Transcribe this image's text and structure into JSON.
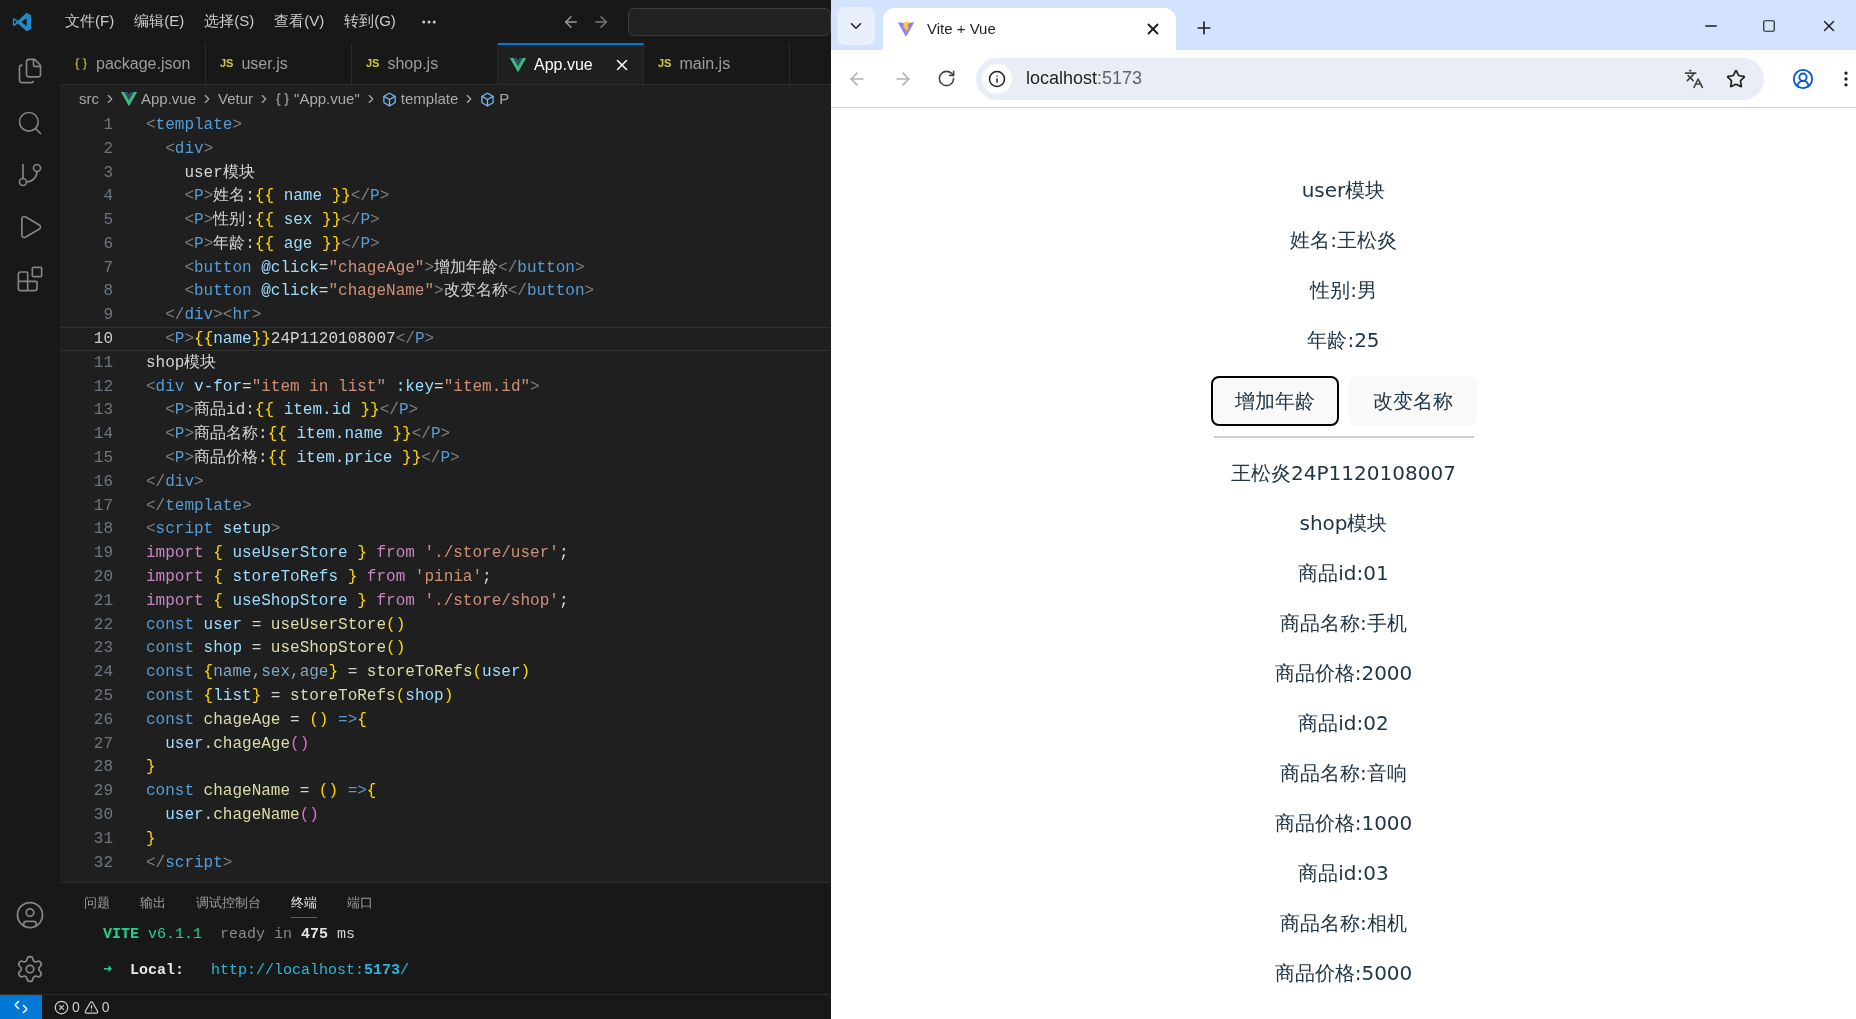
{
  "editor": {
    "menu": [
      "文件(F)",
      "编辑(E)",
      "选择(S)",
      "查看(V)",
      "转到(G)"
    ],
    "tabs": [
      {
        "label": "package.json",
        "kind": "json",
        "selected": false
      },
      {
        "label": "user.js",
        "kind": "js",
        "badge": "JS",
        "selected": false
      },
      {
        "label": "shop.js",
        "kind": "js",
        "badge": "JS",
        "selected": false
      },
      {
        "label": "App.vue",
        "kind": "vue",
        "selected": true
      },
      {
        "label": "main.js",
        "kind": "js",
        "badge": "JS",
        "selected": false
      }
    ],
    "breadcrumb": [
      {
        "label": "src",
        "kind": "folder"
      },
      {
        "label": "App.vue",
        "kind": "vue"
      },
      {
        "label": "Vetur",
        "kind": "plain"
      },
      {
        "label": "\"App.vue\"",
        "kind": "braces"
      },
      {
        "label": "template",
        "kind": "element"
      },
      {
        "label": "P",
        "kind": "element"
      }
    ],
    "lines": [
      {
        "number": "1",
        "active": false,
        "tokens": [
          {
            "text": "<",
            "kind": "punct"
          },
          {
            "text": "template",
            "kind": "tag"
          },
          {
            "text": ">",
            "kind": "punct"
          }
        ]
      },
      {
        "number": "2",
        "active": false,
        "tokens": [
          {
            "text": "  <",
            "kind": "punct"
          },
          {
            "text": "div",
            "kind": "tag"
          },
          {
            "text": ">",
            "kind": "punct"
          }
        ]
      },
      {
        "number": "3",
        "active": false,
        "tokens": [
          {
            "text": "    user模块",
            "kind": "text"
          }
        ]
      },
      {
        "number": "4",
        "active": false,
        "tokens": [
          {
            "text": "    <",
            "kind": "punct"
          },
          {
            "text": "P",
            "kind": "tag"
          },
          {
            "text": ">",
            "kind": "punct"
          },
          {
            "text": "姓名:",
            "kind": "text"
          },
          {
            "text": "{{",
            "kind": "bracket"
          },
          {
            "text": " name ",
            "kind": "var"
          },
          {
            "text": "}}",
            "kind": "bracket"
          },
          {
            "text": "</",
            "kind": "punct"
          },
          {
            "text": "P",
            "kind": "tag"
          },
          {
            "text": ">",
            "kind": "punct"
          }
        ]
      },
      {
        "number": "5",
        "active": false,
        "tokens": [
          {
            "text": "    <",
            "kind": "punct"
          },
          {
            "text": "P",
            "kind": "tag"
          },
          {
            "text": ">",
            "kind": "punct"
          },
          {
            "text": "性别:",
            "kind": "text"
          },
          {
            "text": "{{",
            "kind": "bracket"
          },
          {
            "text": " sex ",
            "kind": "var"
          },
          {
            "text": "}}",
            "kind": "bracket"
          },
          {
            "text": "</",
            "kind": "punct"
          },
          {
            "text": "P",
            "kind": "tag"
          },
          {
            "text": ">",
            "kind": "punct"
          }
        ]
      },
      {
        "number": "6",
        "active": false,
        "tokens": [
          {
            "text": "    <",
            "kind": "punct"
          },
          {
            "text": "P",
            "kind": "tag"
          },
          {
            "text": ">",
            "kind": "punct"
          },
          {
            "text": "年龄:",
            "kind": "text"
          },
          {
            "text": "{{",
            "kind": "bracket"
          },
          {
            "text": " age ",
            "kind": "var"
          },
          {
            "text": "}}",
            "kind": "bracket"
          },
          {
            "text": "</",
            "kind": "punct"
          },
          {
            "text": "P",
            "kind": "tag"
          },
          {
            "text": ">",
            "kind": "punct"
          }
        ]
      },
      {
        "number": "7",
        "active": false,
        "tokens": [
          {
            "text": "    <",
            "kind": "punct"
          },
          {
            "text": "button",
            "kind": "tag"
          },
          {
            "text": " @click",
            "kind": "var"
          },
          {
            "text": "=",
            "kind": "text"
          },
          {
            "text": "\"chageAge\"",
            "kind": "string"
          },
          {
            "text": ">",
            "kind": "punct"
          },
          {
            "text": "增加年龄",
            "kind": "text"
          },
          {
            "text": "</",
            "kind": "punct"
          },
          {
            "text": "button",
            "kind": "tag"
          },
          {
            "text": ">",
            "kind": "punct"
          }
        ]
      },
      {
        "number": "8",
        "active": false,
        "tokens": [
          {
            "text": "    <",
            "kind": "punct"
          },
          {
            "text": "button",
            "kind": "tag"
          },
          {
            "text": " @click",
            "kind": "var"
          },
          {
            "text": "=",
            "kind": "text"
          },
          {
            "text": "\"chageName\"",
            "kind": "string"
          },
          {
            "text": ">",
            "kind": "punct"
          },
          {
            "text": "改变名称",
            "kind": "text"
          },
          {
            "text": "</",
            "kind": "punct"
          },
          {
            "text": "button",
            "kind": "tag"
          },
          {
            "text": ">",
            "kind": "punct"
          }
        ]
      },
      {
        "number": "9",
        "active": false,
        "tokens": [
          {
            "text": "  </",
            "kind": "punct"
          },
          {
            "text": "div",
            "kind": "tag"
          },
          {
            "text": "><",
            "kind": "punct"
          },
          {
            "text": "hr",
            "kind": "tag"
          },
          {
            "text": ">",
            "kind": "punct"
          }
        ]
      },
      {
        "number": "10",
        "active": true,
        "tokens": [
          {
            "text": "  <",
            "kind": "punct"
          },
          {
            "text": "P",
            "kind": "tag"
          },
          {
            "text": ">",
            "kind": "punct"
          },
          {
            "text": "{{",
            "kind": "bracket"
          },
          {
            "text": "name",
            "kind": "var"
          },
          {
            "text": "}}",
            "kind": "bracket"
          },
          {
            "text": "24P1120108007",
            "kind": "text"
          },
          {
            "text": "</",
            "kind": "punct"
          },
          {
            "text": "P",
            "kind": "tag"
          },
          {
            "text": ">",
            "kind": "punct"
          }
        ]
      },
      {
        "number": "11",
        "active": false,
        "tokens": [
          {
            "text": "shop模块",
            "kind": "text"
          }
        ]
      },
      {
        "number": "12",
        "active": false,
        "tokens": [
          {
            "text": "<",
            "kind": "punct"
          },
          {
            "text": "div",
            "kind": "tag"
          },
          {
            "text": " v-for",
            "kind": "var"
          },
          {
            "text": "=",
            "kind": "text"
          },
          {
            "text": "\"item in list\"",
            "kind": "string"
          },
          {
            "text": " :key",
            "kind": "var"
          },
          {
            "text": "=",
            "kind": "text"
          },
          {
            "text": "\"item.id\"",
            "kind": "string"
          },
          {
            "text": ">",
            "kind": "punct"
          }
        ]
      },
      {
        "number": "13",
        "active": false,
        "tokens": [
          {
            "text": "  <",
            "kind": "punct"
          },
          {
            "text": "P",
            "kind": "tag"
          },
          {
            "text": ">",
            "kind": "punct"
          },
          {
            "text": "商品id:",
            "kind": "text"
          },
          {
            "text": "{{",
            "kind": "bracket"
          },
          {
            "text": " item.id ",
            "kind": "var"
          },
          {
            "text": "}}",
            "kind": "bracket"
          },
          {
            "text": "</",
            "kind": "punct"
          },
          {
            "text": "P",
            "kind": "tag"
          },
          {
            "text": ">",
            "kind": "punct"
          }
        ]
      },
      {
        "number": "14",
        "active": false,
        "tokens": [
          {
            "text": "  <",
            "kind": "punct"
          },
          {
            "text": "P",
            "kind": "tag"
          },
          {
            "text": ">",
            "kind": "punct"
          },
          {
            "text": "商品名称:",
            "kind": "text"
          },
          {
            "text": "{{",
            "kind": "bracket"
          },
          {
            "text": " item.name ",
            "kind": "var"
          },
          {
            "text": "}}",
            "kind": "bracket"
          },
          {
            "text": "</",
            "kind": "punct"
          },
          {
            "text": "P",
            "kind": "tag"
          },
          {
            "text": ">",
            "kind": "punct"
          }
        ]
      },
      {
        "number": "15",
        "active": false,
        "tokens": [
          {
            "text": "  <",
            "kind": "punct"
          },
          {
            "text": "P",
            "kind": "tag"
          },
          {
            "text": ">",
            "kind": "punct"
          },
          {
            "text": "商品价格:",
            "kind": "text"
          },
          {
            "text": "{{",
            "kind": "bracket"
          },
          {
            "text": " item.price ",
            "kind": "var"
          },
          {
            "text": "}}",
            "kind": "bracket"
          },
          {
            "text": "</",
            "kind": "punct"
          },
          {
            "text": "P",
            "kind": "tag"
          },
          {
            "text": ">",
            "kind": "punct"
          }
        ]
      },
      {
        "number": "16",
        "active": false,
        "tokens": [
          {
            "text": "</",
            "kind": "punct"
          },
          {
            "text": "div",
            "kind": "tag"
          },
          {
            "text": ">",
            "kind": "punct"
          }
        ]
      },
      {
        "number": "17",
        "active": false,
        "tokens": [
          {
            "text": "</",
            "kind": "punct"
          },
          {
            "text": "template",
            "kind": "tag"
          },
          {
            "text": ">",
            "kind": "punct"
          }
        ]
      },
      {
        "number": "18",
        "active": false,
        "tokens": [
          {
            "text": "<",
            "kind": "punct"
          },
          {
            "text": "script",
            "kind": "tag"
          },
          {
            "text": " setup",
            "kind": "var"
          },
          {
            "text": ">",
            "kind": "punct"
          }
        ]
      },
      {
        "number": "19",
        "active": false,
        "tokens": [
          {
            "text": "import",
            "kind": "keyword"
          },
          {
            "text": " {",
            "kind": "bracket"
          },
          {
            "text": " useUserStore ",
            "kind": "var"
          },
          {
            "text": "}",
            "kind": "bracket"
          },
          {
            "text": " from ",
            "kind": "keyword"
          },
          {
            "text": "'./store/user'",
            "kind": "string"
          },
          {
            "text": ";",
            "kind": "text"
          }
        ]
      },
      {
        "number": "20",
        "active": false,
        "tokens": [
          {
            "text": "import",
            "kind": "keyword"
          },
          {
            "text": " {",
            "kind": "bracket"
          },
          {
            "text": " storeToRefs ",
            "kind": "var"
          },
          {
            "text": "}",
            "kind": "bracket"
          },
          {
            "text": " from ",
            "kind": "keyword"
          },
          {
            "text": "'pinia'",
            "kind": "string"
          },
          {
            "text": ";",
            "kind": "text"
          }
        ]
      },
      {
        "number": "21",
        "active": false,
        "tokens": [
          {
            "text": "import",
            "kind": "keyword"
          },
          {
            "text": " {",
            "kind": "bracket"
          },
          {
            "text": " useShopStore ",
            "kind": "var"
          },
          {
            "text": "}",
            "kind": "bracket"
          },
          {
            "text": " from ",
            "kind": "keyword"
          },
          {
            "text": "'./store/shop'",
            "kind": "string"
          },
          {
            "text": ";",
            "kind": "text"
          }
        ]
      },
      {
        "number": "22",
        "active": false,
        "tokens": [
          {
            "text": "const",
            "kind": "storage"
          },
          {
            "text": " user",
            "kind": "var"
          },
          {
            "text": " = ",
            "kind": "text"
          },
          {
            "text": "useUserStore",
            "kind": "function"
          },
          {
            "text": "()",
            "kind": "bracket"
          }
        ]
      },
      {
        "number": "23",
        "active": false,
        "tokens": [
          {
            "text": "const",
            "kind": "storage"
          },
          {
            "text": " shop",
            "kind": "var"
          },
          {
            "text": " = ",
            "kind": "text"
          },
          {
            "text": "useShopStore",
            "kind": "function"
          },
          {
            "text": "()",
            "kind": "bracket"
          }
        ]
      },
      {
        "number": "24",
        "active": false,
        "tokens": [
          {
            "text": "const",
            "kind": "storage"
          },
          {
            "text": " {",
            "kind": "bracket"
          },
          {
            "text": "name,sex,age",
            "kind": "dimvar"
          },
          {
            "text": "}",
            "kind": "bracket"
          },
          {
            "text": " = ",
            "kind": "text"
          },
          {
            "text": "storeToRefs",
            "kind": "function"
          },
          {
            "text": "(",
            "kind": "bracket"
          },
          {
            "text": "user",
            "kind": "var"
          },
          {
            "text": ")",
            "kind": "bracket"
          }
        ]
      },
      {
        "number": "25",
        "active": false,
        "tokens": [
          {
            "text": "const",
            "kind": "storage"
          },
          {
            "text": " {",
            "kind": "bracket"
          },
          {
            "text": "list",
            "kind": "var"
          },
          {
            "text": "}",
            "kind": "bracket"
          },
          {
            "text": " = ",
            "kind": "text"
          },
          {
            "text": "storeToRefs",
            "kind": "function"
          },
          {
            "text": "(",
            "kind": "bracket"
          },
          {
            "text": "shop",
            "kind": "var"
          },
          {
            "text": ")",
            "kind": "bracket"
          }
        ]
      },
      {
        "number": "26",
        "active": false,
        "tokens": [
          {
            "text": "const",
            "kind": "storage"
          },
          {
            "text": " chageAge",
            "kind": "function"
          },
          {
            "text": " = ",
            "kind": "text"
          },
          {
            "text": "()",
            "kind": "bracket"
          },
          {
            "text": " =>",
            "kind": "storage"
          },
          {
            "text": "{",
            "kind": "bracket"
          }
        ]
      },
      {
        "number": "27",
        "active": false,
        "tokens": [
          {
            "text": "  user",
            "kind": "var"
          },
          {
            "text": ".",
            "kind": "text"
          },
          {
            "text": "chageAge",
            "kind": "function"
          },
          {
            "text": "()",
            "kind": "paren"
          }
        ]
      },
      {
        "number": "28",
        "active": false,
        "tokens": [
          {
            "text": "}",
            "kind": "bracket"
          }
        ]
      },
      {
        "number": "29",
        "active": false,
        "tokens": [
          {
            "text": "const",
            "kind": "storage"
          },
          {
            "text": " chageName",
            "kind": "function"
          },
          {
            "text": " = ",
            "kind": "text"
          },
          {
            "text": "()",
            "kind": "bracket"
          },
          {
            "text": " =>",
            "kind": "storage"
          },
          {
            "text": "{",
            "kind": "bracket"
          }
        ]
      },
      {
        "number": "30",
        "active": false,
        "tokens": [
          {
            "text": "  user",
            "kind": "var"
          },
          {
            "text": ".",
            "kind": "text"
          },
          {
            "text": "chageName",
            "kind": "function"
          },
          {
            "text": "()",
            "kind": "paren"
          }
        ]
      },
      {
        "number": "31",
        "active": false,
        "tokens": [
          {
            "text": "}",
            "kind": "bracket"
          }
        ]
      },
      {
        "number": "32",
        "active": false,
        "tokens": [
          {
            "text": "</",
            "kind": "punct"
          },
          {
            "text": "script",
            "kind": "tag"
          },
          {
            "text": ">",
            "kind": "punct"
          }
        ]
      }
    ],
    "panel_tabs": [
      {
        "label": "问题",
        "selected": false
      },
      {
        "label": "输出",
        "selected": false
      },
      {
        "label": "调试控制台",
        "selected": false
      },
      {
        "label": "终端",
        "selected": true
      },
      {
        "label": "端口",
        "selected": false
      }
    ],
    "terminal": [
      [
        {
          "text": "VITE",
          "kind": "greenbold"
        },
        {
          "text": " v6.1.1",
          "kind": "green"
        },
        {
          "text": "  ready in ",
          "kind": "dim"
        },
        {
          "text": "475",
          "kind": "bold"
        },
        {
          "text": " ms",
          "kind": "text"
        }
      ],
      [
        {
          "text": "➜",
          "kind": "green"
        },
        {
          "text": "  Local:",
          "kind": "bold"
        },
        {
          "text": "   http://localhost:",
          "kind": "link"
        },
        {
          "text": "5173",
          "kind": "linkbold"
        },
        {
          "text": "/",
          "kind": "link"
        }
      ]
    ],
    "status": {
      "errors": "0",
      "warnings": "0"
    }
  },
  "browser": {
    "tab_title": "Vite + Vue",
    "url_host": "localhost",
    "url_port": ":5173",
    "page": {
      "heading": "user模块",
      "fields": [
        "姓名:王松炎",
        "性别:男",
        "年龄:25"
      ],
      "buttons": [
        {
          "label": "增加年龄",
          "focused": true
        },
        {
          "label": "改变名称",
          "focused": false
        }
      ],
      "after_rule": [
        "王松炎24P1120108007",
        "shop模块",
        "商品id:01",
        "商品名称:手机",
        "商品价格:2000",
        "商品id:02",
        "商品名称:音响",
        "商品价格:1000",
        "商品id:03",
        "商品名称:相机",
        "商品价格:5000"
      ]
    }
  }
}
